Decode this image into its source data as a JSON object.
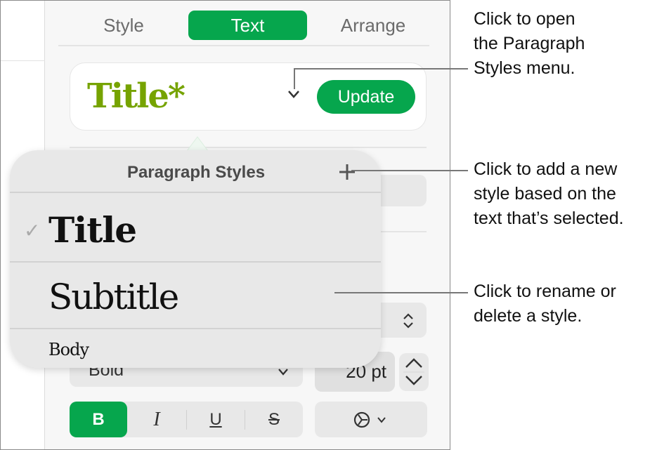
{
  "tabs": [
    {
      "label": "Style"
    },
    {
      "label": "Text"
    },
    {
      "label": "Arrange"
    }
  ],
  "style_box": {
    "current_style": "Title*",
    "update_label": "Update"
  },
  "popup": {
    "title": "Paragraph Styles",
    "items": [
      {
        "label": "Title",
        "checked": true
      },
      {
        "label": "Subtitle"
      },
      {
        "label": "Body"
      }
    ]
  },
  "font": {
    "typeface": "Bold",
    "size": "20 pt"
  },
  "format_buttons": {
    "bold": "B",
    "italic": "I",
    "underline": "U",
    "strike": "S"
  },
  "callouts": [
    "Click to open the Paragraph Styles menu.",
    "Click to add a new style based on the text that’s selected.",
    "Click to rename or delete a style."
  ],
  "callout_lines": [
    [
      "Click to open",
      "the Paragraph",
      "Styles menu."
    ],
    [
      "Click to add a new",
      "style based on the",
      "text that’s selected."
    ],
    [
      "Click to rename or",
      "delete a style."
    ]
  ],
  "colors": {
    "accent": "#06a64d",
    "title_style": "#76a300"
  }
}
